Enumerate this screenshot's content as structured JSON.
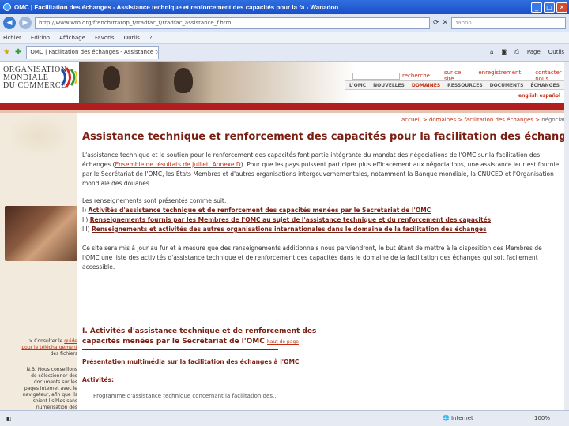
{
  "window": {
    "title": "OMC | Facilitation des échanges - Assistance technique et renforcement des capacités pour la fa - Wanadoo"
  },
  "address": {
    "url": "http://www.wto.org/french/tratop_f/tradfac_f/tradfac_assistance_f.htm",
    "search_placeholder": "Yahoo"
  },
  "menu": [
    "Fichier",
    "Edition",
    "Affichage",
    "Favoris",
    "Outils",
    "?"
  ],
  "tabs": {
    "active_label": "OMC | Facilitation des échanges - Assistance techniq...",
    "tools": [
      "Page",
      "Outils"
    ]
  },
  "header": {
    "logo_lines": [
      "ORGANISATION",
      "MONDIALE",
      "DU COMMERCE"
    ],
    "top_links": [
      "recherche",
      "sur ce site",
      "enregistrement",
      "contacter nous"
    ],
    "nav": [
      "L'OMC",
      "NOUVELLES",
      "DOMAINES",
      "RESSOURCES",
      "DOCUMENTS",
      "ÉCHANGES"
    ],
    "langs": "english  español"
  },
  "breadcrumb": {
    "items": [
      "accueil",
      "domaines",
      "facilitation des échanges"
    ],
    "current": "négociations"
  },
  "content": {
    "title": "Assistance technique et renforcement des capacités pour la facilitation des échanges",
    "intro_part1": "L'assistance technique et le soutien pour le renforcement des capacités font partie intégrante du mandat des négociations de l'OMC sur la facilitation des échanges (",
    "intro_link": "Ensemble de résultats de juillet, Annexe D",
    "intro_part2": "). Pour que les pays puissent participer plus efficacement aux négociations, une assistance leur est fournie par le Secrétariat de l'OMC, les États Membres et d'autres organisations intergouvernementales, notamment la Banque mondiale, la CNUCED et l'Organisation mondiale des douanes.",
    "list_intro": "Les renseignements sont présentés comme suit:",
    "list": [
      {
        "num": "I)",
        "text": "Activités d'assistance technique et de renforcement des capacités menées par le Secrétariat de l'OMC"
      },
      {
        "num": "II)",
        "text": "Renseignements fournis par les Membres de l'OMC au sujet de l'assistance technique et du renforcement des capacités"
      },
      {
        "num": "III)",
        "text": "Renseignements et activités des autres organisations internationales dans le domaine de la facilitation des échanges"
      }
    ],
    "closing": "Ce site sera mis à jour au fur et à mesure que des renseignements additionnels nous parviendront, le but étant de mettre à la disposition des Membres de l'OMC une liste des activités d'assistance technique et de renforcement des capacités dans le domaine de la facilitation des échanges qui soit facilement accessible."
  },
  "section": {
    "title_line1": "I. Activités d'assistance technique et de renforcement des",
    "title_line2": "capacités menées par le Secrétariat de l'OMC",
    "top_link": "haut de page",
    "presentation": "Présentation multimédia sur la facilitation des échanges à l'OMC",
    "activities": "Activités:",
    "bullet": "Programme d'assistance technique concernant la facilitation des..."
  },
  "sidebar": {
    "note1_pre": "> Consulter le ",
    "note1_link": "guide pour le téléchargement",
    "note1_post": " des fichiers",
    "note2": "N.B. Nous conseillons de sélectionner des documents sur les pages internet avec le navigateur, afin que ils soient lisibles sans numérisation des paramètres avec ..."
  },
  "status": {
    "zone": "Internet",
    "zoom": "100%"
  }
}
